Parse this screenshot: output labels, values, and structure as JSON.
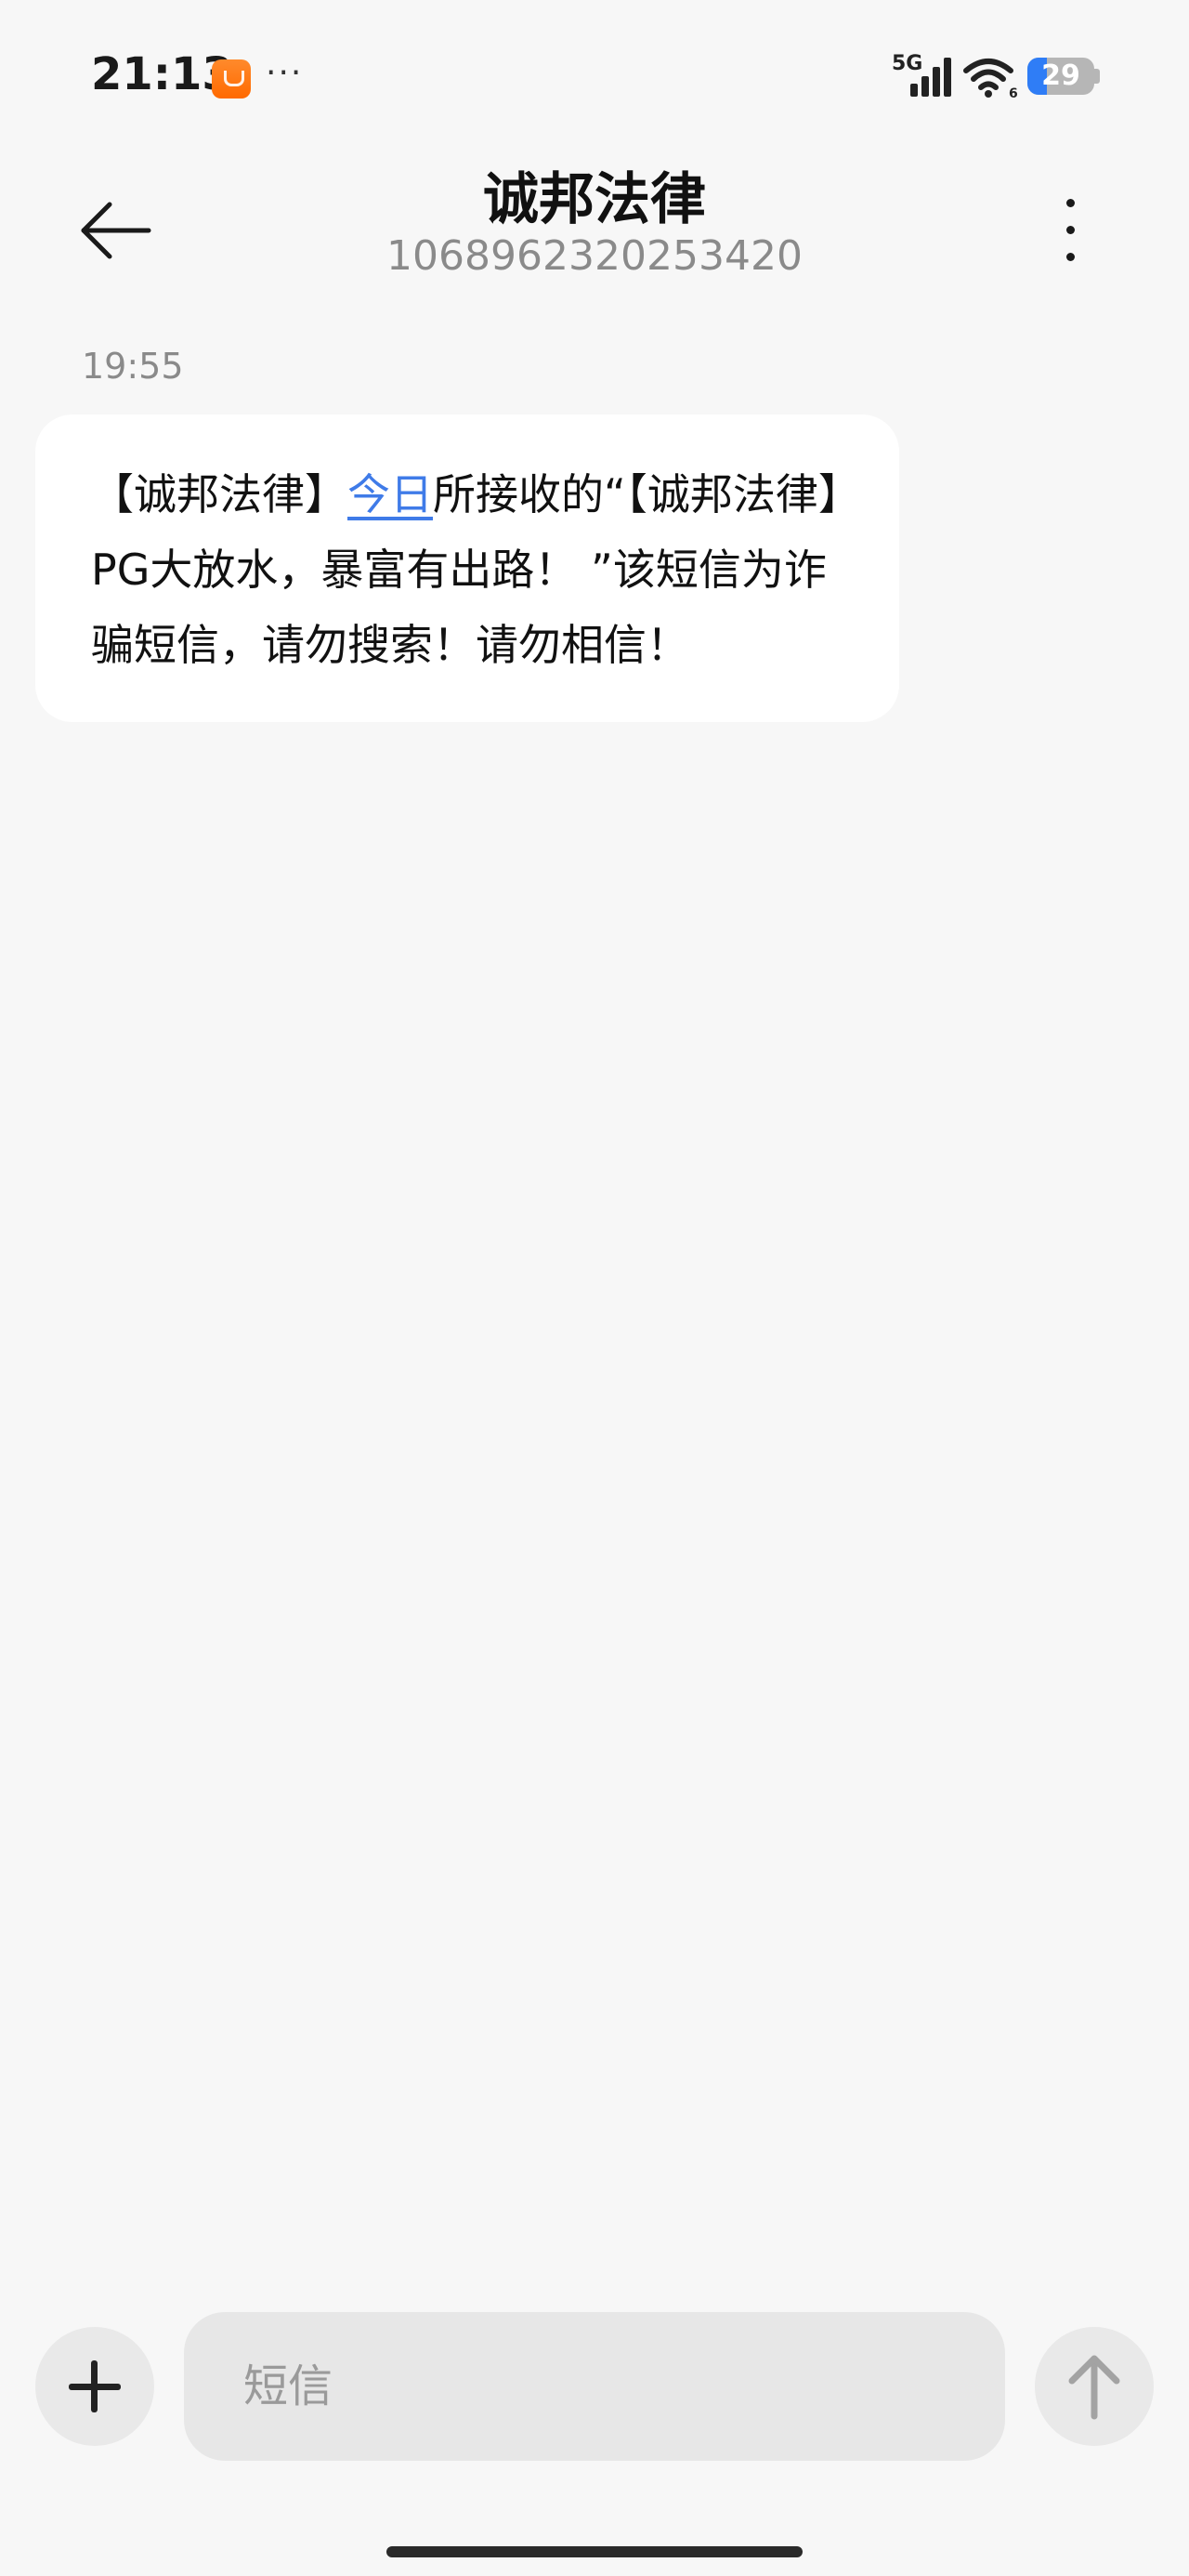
{
  "status_bar": {
    "time": "21:13",
    "more_indicator": "···",
    "network": "5G",
    "wifi_suffix": "6",
    "battery_level": "29",
    "battery_fraction": 0.29,
    "icons": [
      "taobao-notification-icon",
      "signal-icon",
      "wifi-icon",
      "battery-icon"
    ]
  },
  "header": {
    "title": "诚邦法律",
    "subtitle": "1068962320253420",
    "back_icon": "arrow-left-icon",
    "menu_icon": "more-vertical-icon"
  },
  "conversation": {
    "messages": [
      {
        "time": "19:55",
        "text_before": "【诚邦法律】",
        "link_text": "今日",
        "text_after": "所接收的“【诚邦法律】PG大放水，暴富有出路！ ”该短信为诈骗短信，请勿搜索！请勿相信！"
      }
    ]
  },
  "composer": {
    "placeholder": "短信",
    "add_icon": "plus-icon",
    "send_icon": "arrow-up-icon"
  },
  "colors": {
    "background": "#f7f7f7",
    "bubble": "#ffffff",
    "link": "#3f7be8",
    "battery_accent": "#2f7df6",
    "app_icon": "#ff6a00"
  }
}
